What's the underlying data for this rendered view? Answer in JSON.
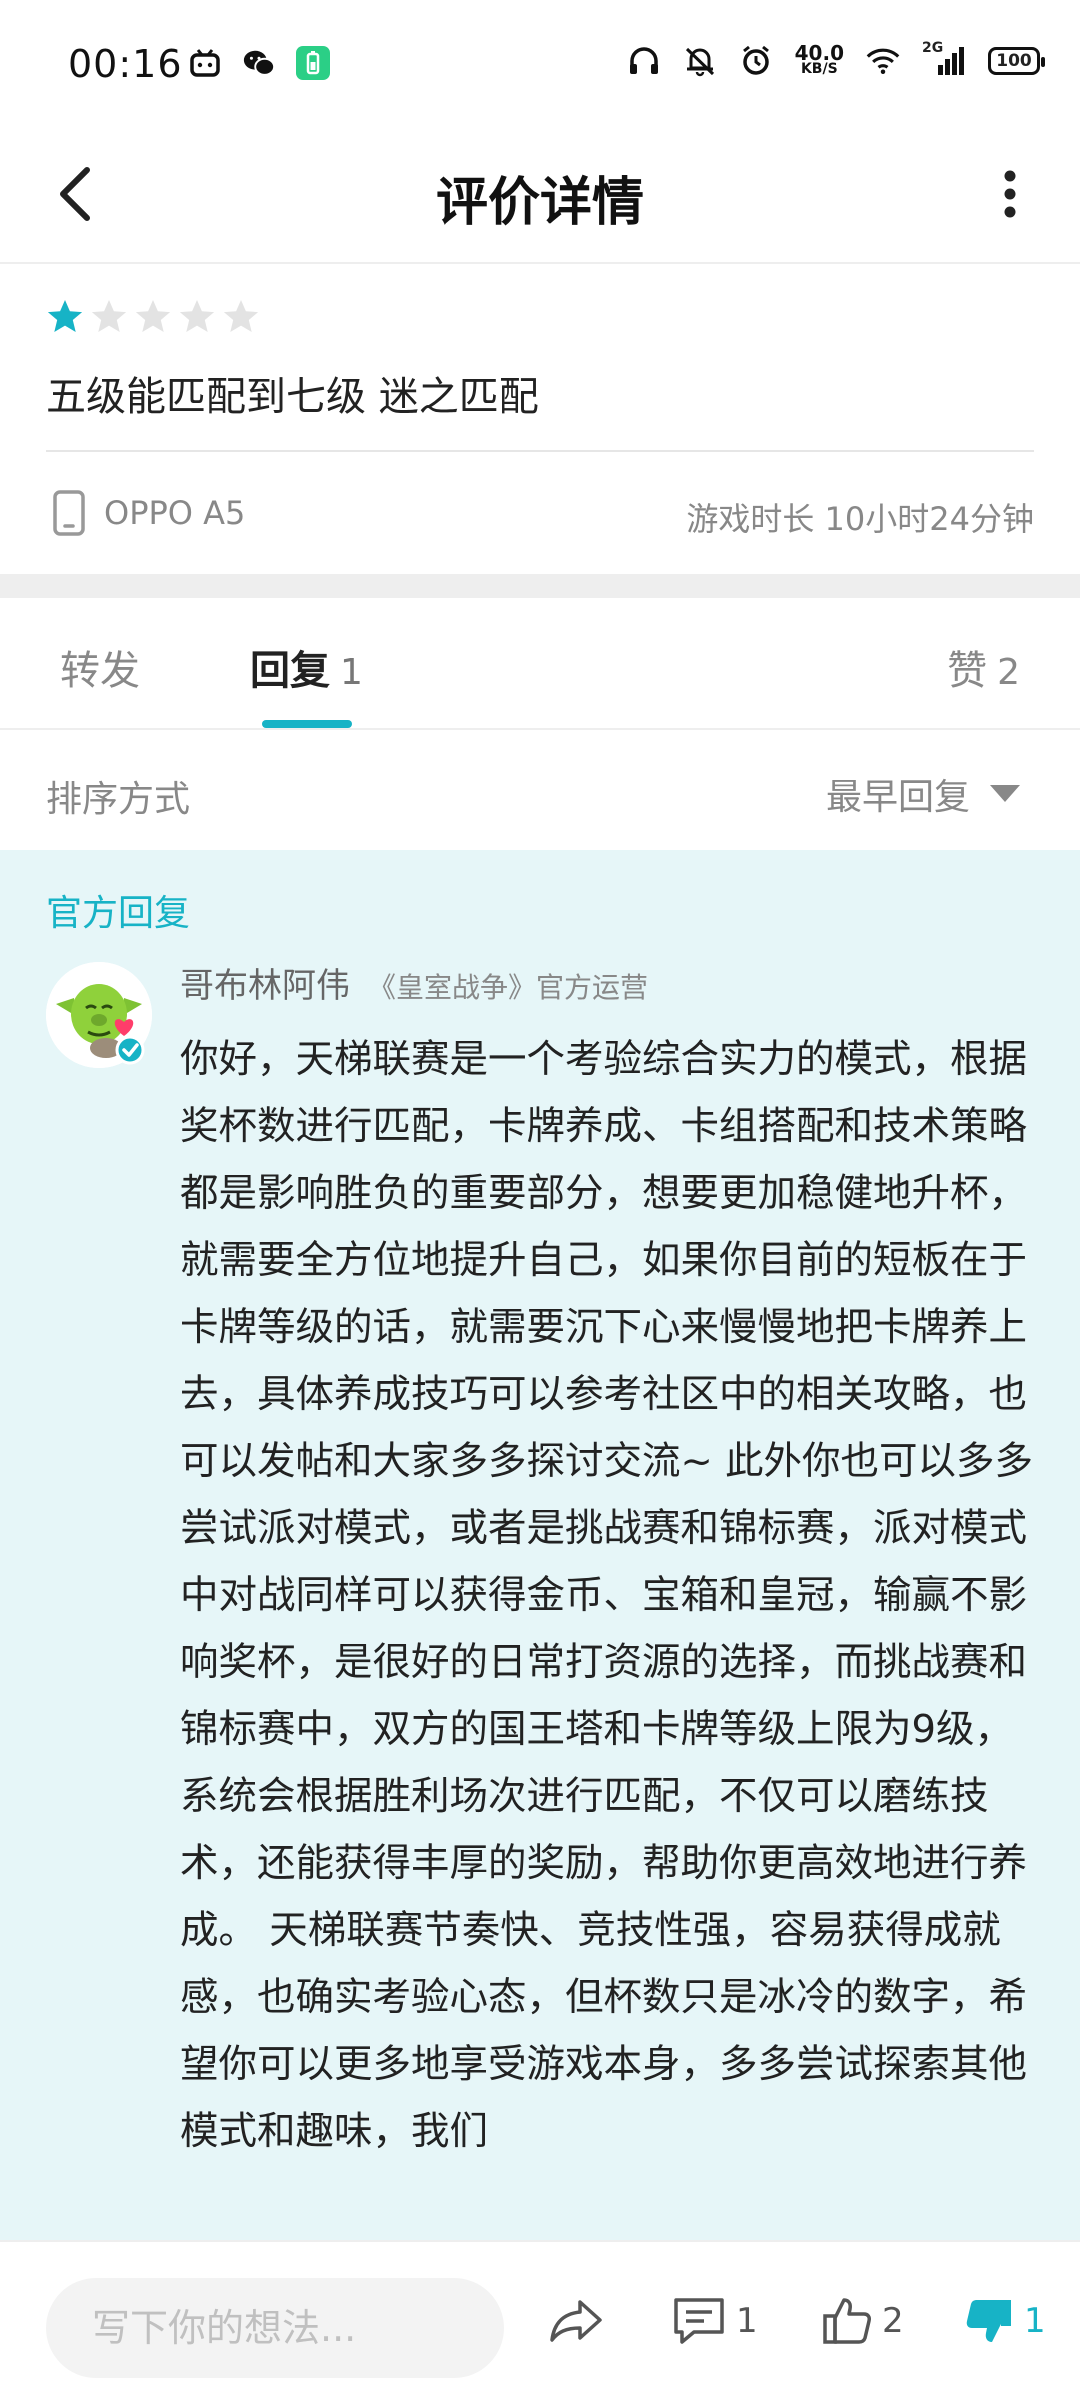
{
  "status_bar": {
    "time": "00:16",
    "net_speed_value": "40.0",
    "net_speed_unit": "KB/S",
    "network_type": "2G",
    "battery": "100"
  },
  "header": {
    "title": "评价详情"
  },
  "review": {
    "rating": 1,
    "max_rating": 5,
    "star_color": "#17b3c6",
    "text": "五级能匹配到七级 迷之匹配",
    "device": "OPPO A5",
    "playtime": "游戏时长 10小时24分钟"
  },
  "tabs": {
    "repost_label": "转发",
    "reply_label": "回复",
    "reply_count": "1",
    "like_label": "赞",
    "like_count": "2"
  },
  "sort": {
    "label": "排序方式",
    "selected": "最早回复"
  },
  "official_reply": {
    "tag": "官方回复",
    "author": "哥布林阿伟",
    "role": "《皇室战争》官方运营",
    "body": "你好，天梯联赛是一个考验综合实力的模式，根据奖杯数进行匹配，卡牌养成、卡组搭配和技术策略都是影响胜负的重要部分，想要更加稳健地升杯，就需要全方位地提升自己，如果你目前的短板在于卡牌等级的话，就需要沉下心来慢慢地把卡牌养上去，具体养成技巧可以参考社区中的相关攻略，也可以发帖和大家多多探讨交流~ 此外你也可以多多尝试派对模式，或者是挑战赛和锦标赛，派对模式中对战同样可以获得金币、宝箱和皇冠，输赢不影响奖杯，是很好的日常打资源的选择，而挑战赛和锦标赛中，双方的国王塔和卡牌等级上限为9级，系统会根据胜利场次进行匹配，不仅可以磨练技术，还能获得丰厚的奖励，帮助你更高效地进行养成。 天梯联赛节奏快、竞技性强，容易获得成就感，也确实考验心态，但杯数只是冰冷的数字，希望你可以更多地享受游戏本身，多多尝试探索其他模式和趣味，我们"
  },
  "bottom_bar": {
    "input_placeholder": "写下你的想法...",
    "comment_count": "1",
    "like_count": "2",
    "dislike_count": "1",
    "accent_color": "#17b3c6"
  }
}
